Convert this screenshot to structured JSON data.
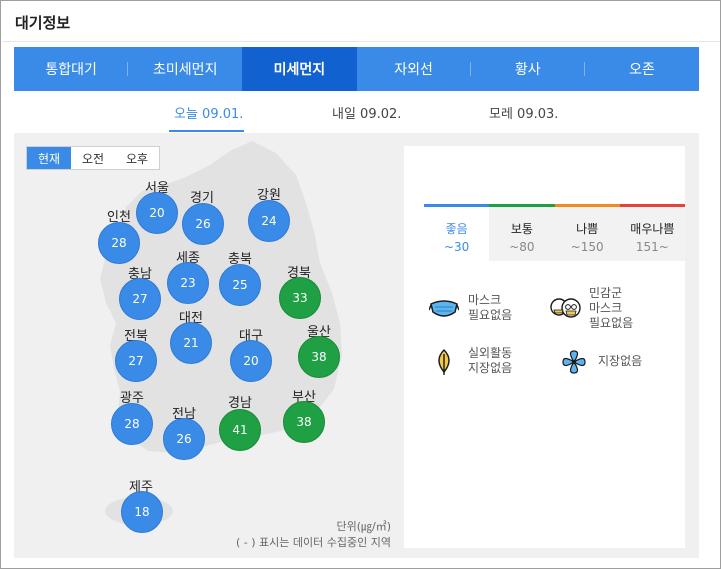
{
  "title": "대기정보",
  "tabs": [
    {
      "label": "통합대기",
      "active": false
    },
    {
      "label": "초미세먼지",
      "active": false
    },
    {
      "label": "미세먼지",
      "active": true
    },
    {
      "label": "자외선",
      "active": false
    },
    {
      "label": "황사",
      "active": false
    },
    {
      "label": "오존",
      "active": false
    }
  ],
  "days": [
    {
      "label": "오늘 09.01.",
      "active": true
    },
    {
      "label": "내일 09.02.",
      "active": false
    },
    {
      "label": "모레 09.03.",
      "active": false
    }
  ],
  "time_tabs": [
    {
      "label": "현재",
      "active": true
    },
    {
      "label": "오전",
      "active": false
    },
    {
      "label": "오후",
      "active": false
    }
  ],
  "regions": [
    {
      "name": "서울",
      "value": "20",
      "level": "good"
    },
    {
      "name": "경기",
      "value": "26",
      "level": "good"
    },
    {
      "name": "강원",
      "value": "24",
      "level": "good"
    },
    {
      "name": "인천",
      "value": "28",
      "level": "good"
    },
    {
      "name": "충남",
      "value": "27",
      "level": "good"
    },
    {
      "name": "세종",
      "value": "23",
      "level": "good"
    },
    {
      "name": "충북",
      "value": "25",
      "level": "good"
    },
    {
      "name": "경북",
      "value": "33",
      "level": "normal"
    },
    {
      "name": "전북",
      "value": "27",
      "level": "good"
    },
    {
      "name": "대전",
      "value": "21",
      "level": "good"
    },
    {
      "name": "대구",
      "value": "20",
      "level": "good"
    },
    {
      "name": "울산",
      "value": "38",
      "level": "normal"
    },
    {
      "name": "광주",
      "value": "28",
      "level": "good"
    },
    {
      "name": "전남",
      "value": "26",
      "level": "good"
    },
    {
      "name": "경남",
      "value": "41",
      "level": "normal"
    },
    {
      "name": "부산",
      "value": "38",
      "level": "normal"
    },
    {
      "name": "제주",
      "value": "18",
      "level": "good"
    }
  ],
  "unit": "단위(㎍/㎥)",
  "note": "( - ) 표시는 데이터 수집중인 지역",
  "levels": [
    {
      "name": "좋음",
      "range": "~30",
      "color": "#3a8be8",
      "active": true
    },
    {
      "name": "보통",
      "range": "~80",
      "color": "#1fa044",
      "active": false
    },
    {
      "name": "나쁨",
      "range": "~150",
      "color": "#f08c1e",
      "active": false
    },
    {
      "name": "매우나쁨",
      "range": "151~",
      "color": "#e8413a",
      "active": false
    }
  ],
  "tips": [
    {
      "icon": "mask-icon",
      "line1": "마스크",
      "line2": "필요없음",
      "line3": ""
    },
    {
      "icon": "sensitive-group-icon",
      "line1": "민감군",
      "line2": "마스크",
      "line3": "필요없음"
    },
    {
      "icon": "leaf-icon",
      "line1": "실외활동",
      "line2": "지장없음",
      "line3": ""
    },
    {
      "icon": "fan-icon",
      "line1": "지장없음",
      "line2": "",
      "line3": ""
    }
  ],
  "colors": {
    "accent": "#3a8be8",
    "accent_dark": "#1261d1",
    "good": "#3a8be8",
    "normal": "#1fa044"
  }
}
